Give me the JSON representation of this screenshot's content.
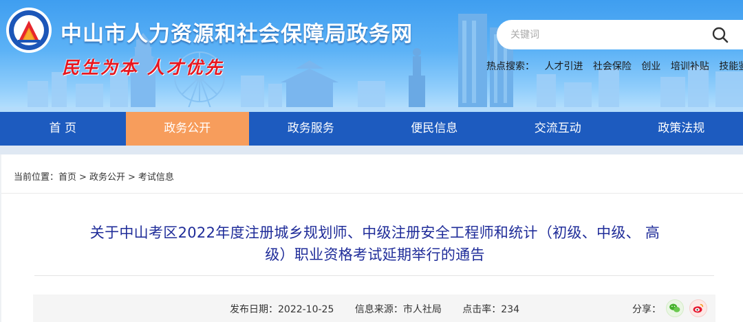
{
  "header": {
    "site_title": "中山市人力资源和社会保障局政务网",
    "slogan": "民生为本 人才优先",
    "search_placeholder": "关键词",
    "hot_search_label": "热点搜索：",
    "hot_search_links": [
      "人才引进",
      "社会保险",
      "创业",
      "培训补贴",
      "技能鉴定"
    ]
  },
  "nav": {
    "items": [
      {
        "label": "首 页"
      },
      {
        "label": "政务公开"
      },
      {
        "label": "政务服务"
      },
      {
        "label": "便民信息"
      },
      {
        "label": "交流互动"
      },
      {
        "label": "政策法规"
      }
    ],
    "active_index": 1
  },
  "breadcrumb": {
    "prefix": "当前位置：",
    "items": [
      "首页",
      "政务公开",
      "考试信息"
    ],
    "separator": ">"
  },
  "article": {
    "title_line1": "关于中山考区2022年度注册城乡规划师、中级注册安全工程师和统计（初级、中级、 高",
    "title_line2": "级）职业资格考试延期举行的通告",
    "publish_date": "发布日期：2022-10-25",
    "source": "信息来源：市人社局",
    "clicks": "点击率：234",
    "share_label": "分享："
  },
  "colors": {
    "nav_bg": "#1d5bbf",
    "nav_active": "#f79d5c",
    "title_color": "#1f2c99",
    "slogan_color": "#e8171f"
  }
}
